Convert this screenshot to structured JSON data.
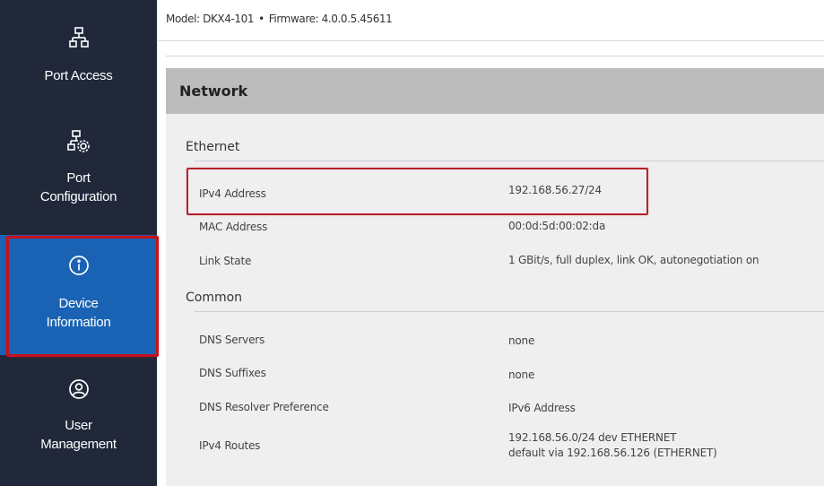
{
  "header": {
    "model_label": "Model: DKX4-101",
    "separator": "•",
    "firmware_label": "Firmware: 4.0.0.5.45611"
  },
  "sidebar": {
    "items": [
      {
        "label_lines": [
          "Port Access"
        ],
        "icon": "network-icon",
        "active": false
      },
      {
        "label_lines": [
          "Port",
          "Configuration"
        ],
        "icon": "network-gear-icon",
        "active": false
      },
      {
        "label_lines": [
          "Device",
          "Information"
        ],
        "icon": "info-circle-icon",
        "active": true
      },
      {
        "label_lines": [
          "User",
          "Management"
        ],
        "icon": "user-circle-icon",
        "active": false
      }
    ]
  },
  "panel": {
    "title": "Network",
    "sections": [
      {
        "title": "Ethernet",
        "rows": [
          {
            "label": "IPv4 Address",
            "value": [
              "192.168.56.27/24"
            ]
          },
          {
            "label": "MAC Address",
            "value": [
              "00:0d:5d:00:02:da"
            ]
          },
          {
            "label": "Link State",
            "value": [
              "1 GBit/s, full duplex, link OK, autonegotiation on"
            ]
          }
        ]
      },
      {
        "title": "Common",
        "rows": [
          {
            "label": "DNS Servers",
            "value": [
              "none"
            ]
          },
          {
            "label": "DNS Suffixes",
            "value": [
              "none"
            ]
          },
          {
            "label": "DNS Resolver Preference",
            "value": [
              "IPv6 Address"
            ]
          },
          {
            "label": "IPv4 Routes",
            "value": [
              "192.168.56.0/24 dev ETHERNET",
              "default via 192.168.56.126 (ETHERNET)"
            ]
          }
        ]
      }
    ]
  },
  "colors": {
    "sidebar_bg": "#20283a",
    "active_item_bg": "#1a63b4",
    "highlight_red": "#c8101a",
    "panel_header_bg": "#bcbcbc",
    "panel_bg": "#efefef"
  }
}
